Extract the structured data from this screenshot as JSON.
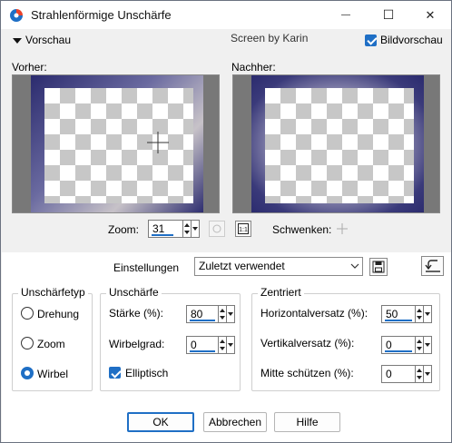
{
  "window": {
    "title": "Strahlenförmige Unschärfe",
    "minimize": "—",
    "maximize": "☐",
    "close": "✕"
  },
  "header": {
    "vorschau_label": "Vorschau",
    "credit": "Screen by Karin",
    "bildvorschau_label": "Bildvorschau",
    "bildvorschau_checked": true
  },
  "preview": {
    "before_label": "Vorher:",
    "after_label": "Nachher:",
    "zoom_label": "Zoom:",
    "zoom_value": "31",
    "pan_label": "Schwenken:"
  },
  "settings": {
    "label": "Einstellungen",
    "preset_value": "Zuletzt verwendet"
  },
  "blur_type": {
    "title": "Unschärfetyp",
    "options": [
      {
        "label": "Drehung",
        "selected": false
      },
      {
        "label": "Zoom",
        "selected": false
      },
      {
        "label": "Wirbel",
        "selected": true
      }
    ]
  },
  "blur": {
    "title": "Unschärfe",
    "strength_label": "Stärke (%):",
    "strength_value": "80",
    "twist_label": "Wirbelgrad:",
    "twist_value": "0",
    "elliptic_label": "Elliptisch",
    "elliptic_checked": true
  },
  "centered": {
    "title": "Zentriert",
    "h_offset_label": "Horizontalversatz (%):",
    "h_offset_value": "50",
    "v_offset_label": "Vertikalversatz (%):",
    "v_offset_value": "0",
    "protect_label": "Mitte schützen (%):",
    "protect_value": "0"
  },
  "buttons": {
    "ok": "OK",
    "cancel": "Abbrechen",
    "help": "Hilfe"
  },
  "colors": {
    "accent": "#1f6fc5",
    "frame_blue": "#2a2a72"
  }
}
